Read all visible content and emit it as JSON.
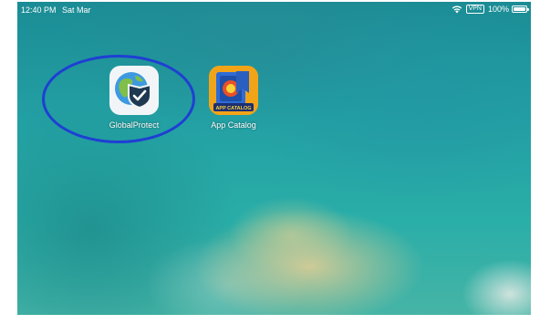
{
  "status_bar": {
    "time": "12:40 PM",
    "date": "Sat Mar",
    "vpn": "VPN",
    "battery": "100%",
    "battery_level": 1.0
  },
  "apps": [
    {
      "label": "GlobalProtect",
      "icon": "globalprotect-icon"
    },
    {
      "label": "App Catalog",
      "icon": "app-catalog-icon"
    }
  ],
  "app_catalog_icon_text": "APP CATALOG",
  "colors": {
    "highlight": "#1f3fd3",
    "wallpaper": "#23a1a4",
    "app_catalog_bg": "#f2a419"
  }
}
